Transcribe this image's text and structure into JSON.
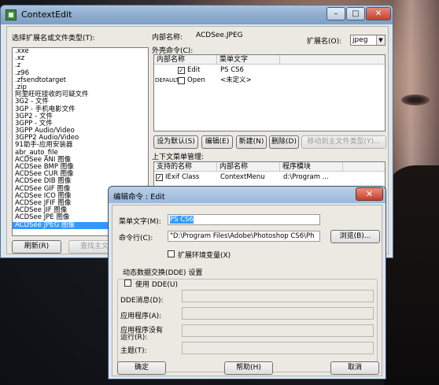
{
  "main_window": {
    "title": "ContextEdit",
    "minimize_label": "–",
    "maximize_label": "□",
    "close_label": "✕",
    "list_label": "选择扩展名或文件类型(T):",
    "list_items": [
      ".xxe",
      ".xz",
      ".z",
      ".z96",
      ".zfsendtotarget",
      ".zip",
      "阿里旺旺接收的可疑文件",
      "3G2 - 文件",
      "3GP - 手机电影文件",
      "3GP2 - 文件",
      "3GPP - 文件",
      "3GPP Audio/Video",
      "3GPP2 Audio/Video",
      "91助手-应用安装器",
      "abr_auto_file",
      "ACDSee ANI 图像",
      "ACDSee BMP 图像",
      "ACDSee CUR 图像",
      "ACDSee DIB 图像",
      "ACDSee GIF 图像",
      "ACDSee ICO 图像",
      "ACDSee JFIF 图像",
      "ACDSee JIF 图像",
      "ACDSee JPE 图像",
      "ACDSee JPEG 图像"
    ],
    "selected_index": 24,
    "refresh_button": "刷新(R)",
    "find_button": "查找主文件",
    "internal_name_label": "内部名称:",
    "internal_name_value": "ACDSee.JPEG",
    "ext_label": "扩展名(O):",
    "ext_value": "jpeg",
    "shell_cmd_label": "外壳命令(C):",
    "shell_grid": {
      "headers": [
        "内部名称",
        "菜单文字"
      ],
      "rows": [
        {
          "checked": true,
          "prefix": "",
          "internal": "Edit",
          "menu": "PS CS6"
        },
        {
          "checked": false,
          "prefix": "DEFAULT",
          "internal": "Open",
          "menu": "<未定义>"
        }
      ]
    },
    "buttons": {
      "set_default": "设为默认(S)",
      "edit": "编辑(E)",
      "new": "新建(N)",
      "delete": "删除(D)",
      "move": "移动到主文件类型(Y)..."
    },
    "context_label": "上下文菜单管理:",
    "context_grid": {
      "headers": [
        "支持的名称",
        "内部名称",
        "程序模块"
      ],
      "rows": [
        {
          "checked": true,
          "name": "IExif Class",
          "internal": "ContextMenu",
          "module": "d:\\Program ..."
        }
      ]
    }
  },
  "edit_dialog": {
    "title": "编辑命令 : Edit",
    "close_label": "✕",
    "menu_text_label": "菜单文字(M):",
    "menu_text_value": "PS CS6",
    "cmdline_label": "命令行(C):",
    "cmdline_value": "\"D:\\Program Files\\Adobe\\Photoshop CS6\\Ph",
    "browse_button": "浏览(B)...",
    "expand_env_label": "扩展环境变量(X)",
    "dde_group_label": "动态数据交换(DDE) 设置",
    "use_dde_label": "使用 DDE(U)",
    "dde_msg_label": "DDE消息(D):",
    "app_label": "应用程序(A):",
    "app_not_running_label_1": "应用程序没有",
    "app_not_running_label_2": "运行(R):",
    "topic_label": "主题(T):",
    "ok_button": "确定",
    "help_button": "帮助(H)",
    "cancel_button": "取消"
  }
}
